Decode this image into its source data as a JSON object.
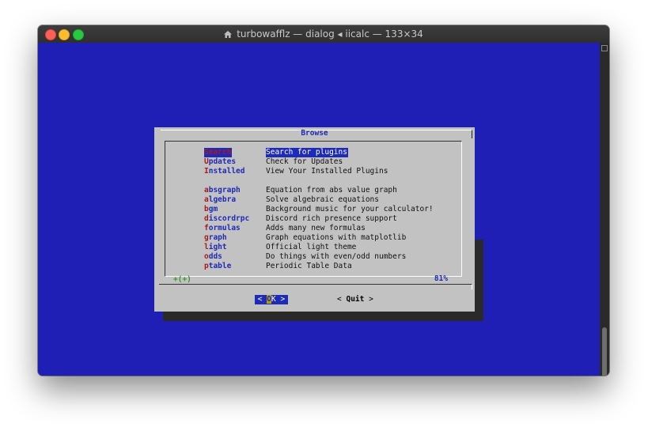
{
  "window": {
    "title": "turbowafflz — dialog ◂ iicalc — 133×34",
    "colors": {
      "terminal_bg": "#1f1fb5",
      "dialog_bg": "#c2c2c2",
      "accent": "#1e2ab8",
      "hotkey": "#b01818"
    }
  },
  "dialog": {
    "title": "Browse",
    "items": [
      {
        "tag_hot": "S",
        "tag_rest": "earch",
        "desc": "Search for plugins",
        "selected": true
      },
      {
        "tag_hot": "U",
        "tag_rest": "pdates",
        "desc": "Check for Updates"
      },
      {
        "tag_hot": "I",
        "tag_rest": "nstalled",
        "desc": "View Your Installed Plugins"
      },
      {
        "tag_hot": "a",
        "tag_rest": "bsgraph",
        "desc": "Equation from abs value graph"
      },
      {
        "tag_hot": "a",
        "tag_rest": "lgebra",
        "desc": "Solve algebraic equations"
      },
      {
        "tag_hot": "b",
        "tag_rest": "gm",
        "desc": "Background music for your calculator!"
      },
      {
        "tag_hot": "d",
        "tag_rest": "iscordrpc",
        "desc": "Discord rich presence support"
      },
      {
        "tag_hot": "f",
        "tag_rest": "ormulas",
        "desc": "Adds many new formulas"
      },
      {
        "tag_hot": "g",
        "tag_rest": "raph",
        "desc": "Graph equations with matplotlib"
      },
      {
        "tag_hot": "l",
        "tag_rest": "ight",
        "desc": "Official light theme"
      },
      {
        "tag_hot": "o",
        "tag_rest": "dds",
        "desc": "Do things with even/odd numbers"
      },
      {
        "tag_hot": "p",
        "tag_rest": "table",
        "desc": "Periodic Table Data"
      }
    ],
    "more_indicator": "+(+)",
    "percent": "81%",
    "ok_button": {
      "left": "<",
      "hot": "O",
      "rest": "K",
      "right": ">"
    },
    "quit_button": {
      "left": "<",
      "label": "Quit",
      "right": ">"
    }
  }
}
